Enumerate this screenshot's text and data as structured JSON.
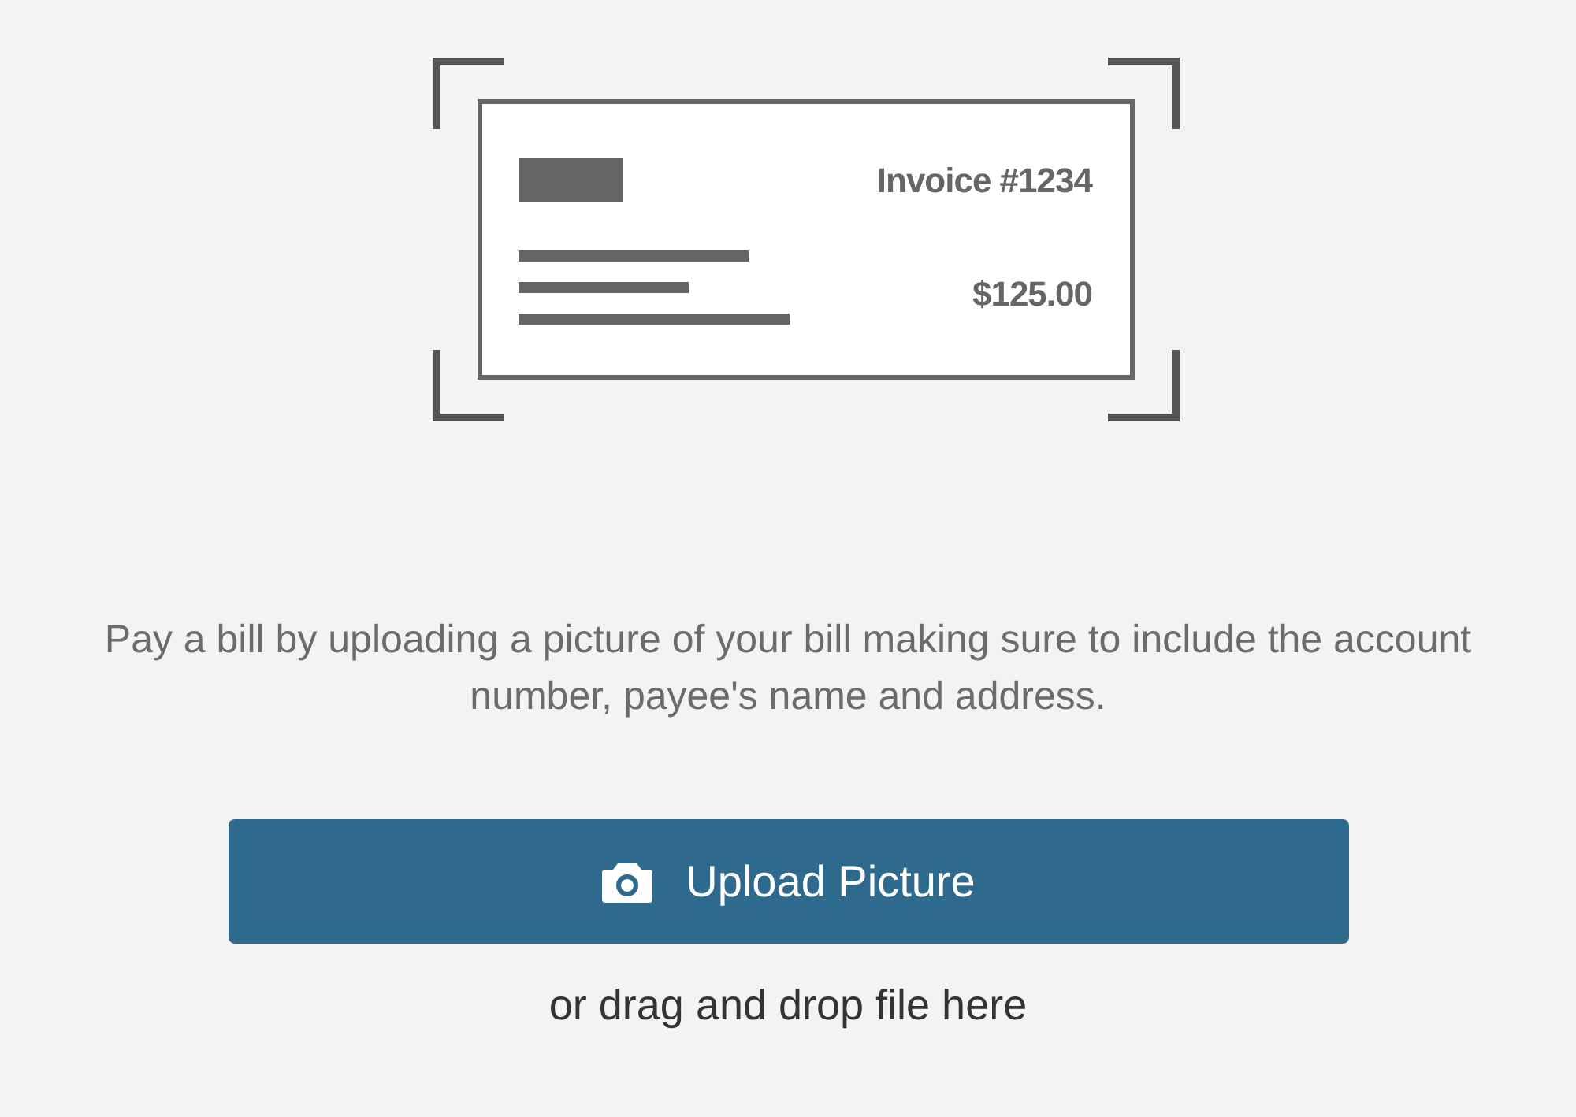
{
  "invoice": {
    "number": "Invoice #1234",
    "amount": "$125.00"
  },
  "instructions": "Pay a bill by uploading a picture of your bill making sure to include the account number, payee's name and address.",
  "upload_button": {
    "label": "Upload Picture"
  },
  "drop_hint": "or drag and drop file here"
}
